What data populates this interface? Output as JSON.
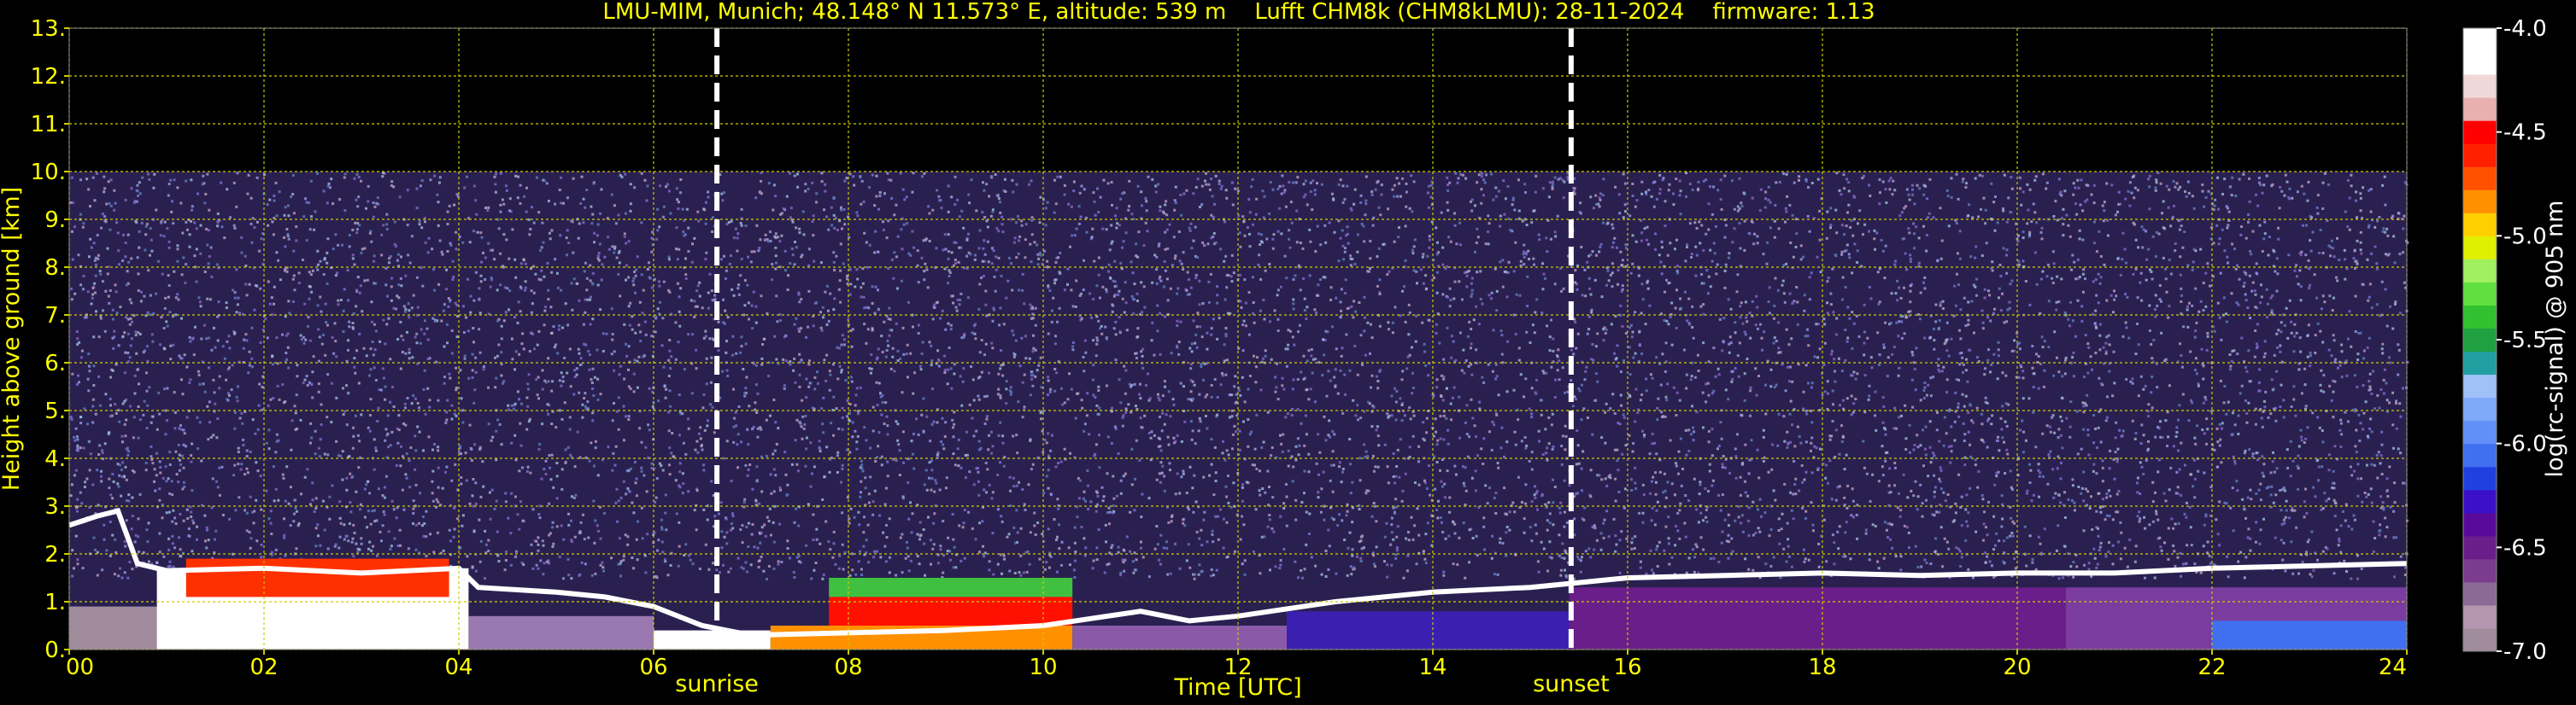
{
  "chart_data": {
    "type": "heatmap",
    "title": "LMU-MIM, Munich; 48.148° N 11.573° E, altitude: 539 m    Lufft CHM8k (CHM8kLMU): 28-11-2024    firmware: 1.13",
    "xlabel": "Time [UTC]",
    "ylabel": "Height above ground [km]",
    "colorbar_label": "log(rc-signal) @ 905 nm",
    "xlim": [
      0,
      24
    ],
    "ylim": [
      0,
      13
    ],
    "x_ticks": [
      0,
      2,
      4,
      6,
      8,
      10,
      12,
      14,
      16,
      18,
      20,
      22,
      24
    ],
    "x_tick_labels": [
      "00",
      "02",
      "04",
      "06",
      "08",
      "10",
      "12",
      "14",
      "16",
      "18",
      "20",
      "22",
      "24"
    ],
    "y_ticks": [
      0,
      1,
      2,
      3,
      4,
      5,
      6,
      7,
      8,
      9,
      10,
      11,
      12,
      13
    ],
    "y_tick_labels": [
      "0.",
      "1.",
      "2.",
      "3.",
      "4.",
      "5.",
      "6.",
      "7.",
      "8.",
      "9.",
      "10.",
      "11.",
      "12.",
      "13."
    ],
    "grid": true,
    "colorbar": {
      "ticks": [
        -4.0,
        -4.5,
        -5.0,
        -5.5,
        -6.0,
        -6.5,
        -7.0
      ],
      "tick_labels": [
        "-4.0",
        "-4.5",
        "-5.0",
        "-5.5",
        "-6.0",
        "-6.5",
        "-7.0"
      ],
      "range": [
        -7.0,
        -4.0
      ],
      "colors": [
        "#a08c9c",
        "#b496ae",
        "#8c6a96",
        "#7a3c8e",
        "#6a1e8a",
        "#5a0a9a",
        "#3a10c8",
        "#2040e0",
        "#4070f0",
        "#6090f8",
        "#80a8f8",
        "#a0c0f8",
        "#20a0a0",
        "#20a040",
        "#30c030",
        "#60e040",
        "#a0f060",
        "#e0f000",
        "#ffd000",
        "#ff9000",
        "#ff5000",
        "#ff2000",
        "#ff0000",
        "#e8b0b0",
        "#f0d8d8",
        "#ffffff",
        "#ffffff"
      ]
    },
    "markers": [
      {
        "label": "sunrise",
        "x": 6.65
      },
      {
        "label": "sunset",
        "x": 15.42
      }
    ],
    "signal_top_km": 10.0,
    "noise_colors": [
      "#7878d8",
      "#9aa0e8",
      "#b0b0d0",
      "#8868c8",
      "#a0c0e0",
      "#c0a0c0",
      "#6080c0"
    ],
    "layers": [
      {
        "x0": 0.0,
        "x1": 0.9,
        "y0": 0.0,
        "y1": 0.9,
        "color": "#a08c9c"
      },
      {
        "x0": 0.9,
        "x1": 4.1,
        "y0": 0.0,
        "y1": 1.7,
        "color": "#ffffff"
      },
      {
        "x0": 1.2,
        "x1": 3.9,
        "y0": 1.1,
        "y1": 1.9,
        "color": "#ff3000"
      },
      {
        "x0": 4.1,
        "x1": 6.0,
        "y0": 0.0,
        "y1": 0.7,
        "color": "#9a78b0"
      },
      {
        "x0": 6.0,
        "x1": 7.2,
        "y0": 0.0,
        "y1": 0.4,
        "color": "#ffffff"
      },
      {
        "x0": 7.2,
        "x1": 10.3,
        "y0": 0.0,
        "y1": 0.5,
        "color": "#ff9000"
      },
      {
        "x0": 7.8,
        "x1": 10.3,
        "y0": 0.5,
        "y1": 1.1,
        "color": "#ff1000"
      },
      {
        "x0": 7.8,
        "x1": 10.3,
        "y0": 1.1,
        "y1": 1.5,
        "color": "#40c040"
      },
      {
        "x0": 10.3,
        "x1": 12.5,
        "y0": 0.0,
        "y1": 0.5,
        "color": "#8a5aa8"
      },
      {
        "x0": 12.5,
        "x1": 15.4,
        "y0": 0.0,
        "y1": 0.8,
        "color": "#3a20b0"
      },
      {
        "x0": 15.4,
        "x1": 20.5,
        "y0": 0.0,
        "y1": 1.3,
        "color": "#6a1e8a"
      },
      {
        "x0": 20.5,
        "x1": 24.0,
        "y0": 0.0,
        "y1": 1.3,
        "color": "#7a3c9e"
      },
      {
        "x0": 22.0,
        "x1": 24.0,
        "y0": 0.0,
        "y1": 0.6,
        "color": "#4070f0"
      }
    ],
    "boundary_layer_top": {
      "x": [
        0.0,
        0.3,
        0.5,
        0.7,
        1.0,
        2.0,
        3.0,
        4.0,
        4.2,
        5.0,
        5.5,
        6.0,
        6.5,
        7.0,
        8.0,
        9.0,
        10.0,
        11.0,
        11.5,
        12.0,
        13.0,
        14.0,
        15.0,
        15.5,
        16.0,
        17.0,
        18.0,
        19.0,
        20.0,
        21.0,
        22.0,
        23.0,
        24.0
      ],
      "y": [
        2.6,
        2.8,
        2.9,
        1.8,
        1.65,
        1.7,
        1.6,
        1.7,
        1.3,
        1.2,
        1.1,
        0.9,
        0.5,
        0.3,
        0.35,
        0.4,
        0.5,
        0.8,
        0.6,
        0.7,
        1.0,
        1.2,
        1.3,
        1.4,
        1.5,
        1.55,
        1.6,
        1.55,
        1.6,
        1.6,
        1.7,
        1.75,
        1.8
      ]
    }
  }
}
